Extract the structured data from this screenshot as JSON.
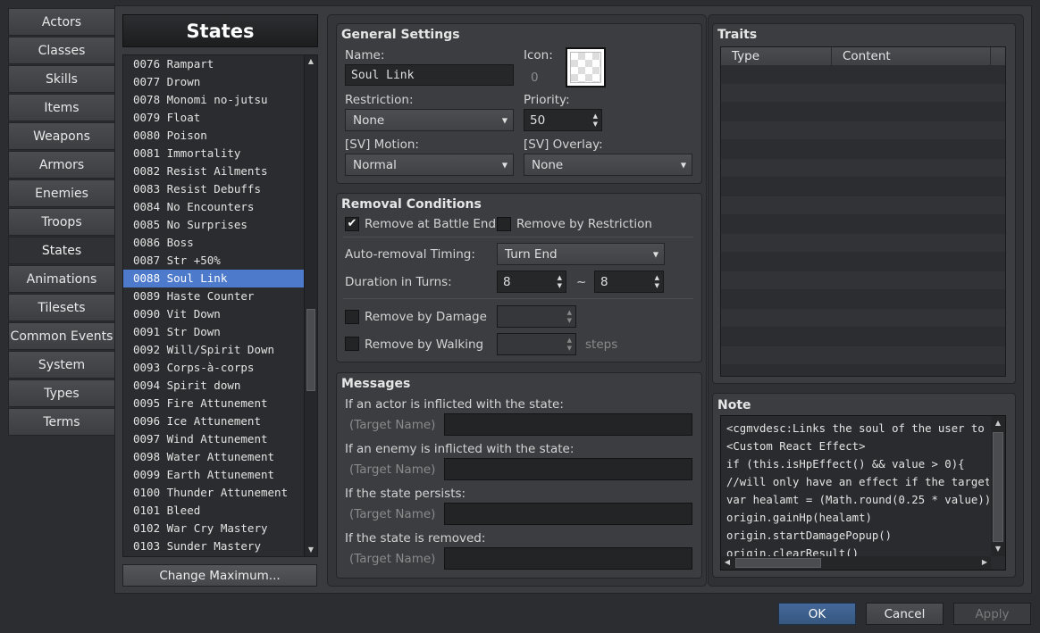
{
  "tabs": [
    "Actors",
    "Classes",
    "Skills",
    "Items",
    "Weapons",
    "Armors",
    "Enemies",
    "Troops",
    "States",
    "Animations",
    "Tilesets",
    "Common Events",
    "System",
    "Types",
    "Terms"
  ],
  "active_tab": "States",
  "list_header": "States",
  "list_items": [
    "0076 Rampart",
    "0077 Drown",
    "0078 Monomi no-jutsu",
    "0079 Float",
    "0080 Poison",
    "0081 Immortality",
    "0082 Resist Ailments",
    "0083 Resist Debuffs",
    "0084 No Encounters",
    "0085 No Surprises",
    "0086 Boss",
    "0087 Str +50%",
    "0088 Soul Link",
    "0089 Haste Counter",
    "0090 Vit Down",
    "0091 Str Down",
    "0092 Will/Spirit Down",
    "0093 Corps-à-corps",
    "0094 Spirit down",
    "0095 Fire Attunement",
    "0096 Ice Attunement",
    "0097 Wind Attunement",
    "0098 Water Attunement",
    "0099 Earth Attunement",
    "0100 Thunder Attunement",
    "0101 Bleed",
    "0102 War Cry Mastery",
    "0103 Sunder Mastery"
  ],
  "selected_item": "0088 Soul Link",
  "change_max_label": "Change Maximum...",
  "general": {
    "title": "General Settings",
    "name_label": "Name:",
    "name_value": "Soul Link",
    "icon_label": "Icon:",
    "icon_index": "0",
    "restriction_label": "Restriction:",
    "restriction_value": "None",
    "priority_label": "Priority:",
    "priority_value": "50",
    "motion_label": "[SV] Motion:",
    "motion_value": "Normal",
    "overlay_label": "[SV] Overlay:",
    "overlay_value": "None"
  },
  "removal": {
    "title": "Removal Conditions",
    "at_battle_end_label": "Remove at Battle End",
    "at_battle_end_checked": true,
    "by_restriction_label": "Remove by Restriction",
    "by_restriction_checked": false,
    "timing_label": "Auto-removal Timing:",
    "timing_value": "Turn End",
    "duration_label": "Duration in Turns:",
    "duration_min": "8",
    "duration_tilde": "~",
    "duration_max": "8",
    "by_damage_label": "Remove by Damage",
    "by_damage_checked": false,
    "by_walking_label": "Remove by Walking",
    "by_walking_checked": false,
    "steps_label": "steps"
  },
  "messages": {
    "title": "Messages",
    "items": [
      {
        "label": "If an actor is inflicted with the state:",
        "prefix": "(Target Name)",
        "value": ""
      },
      {
        "label": "If an enemy is inflicted with the state:",
        "prefix": "(Target Name)",
        "value": ""
      },
      {
        "label": "If the state persists:",
        "prefix": "(Target Name)",
        "value": ""
      },
      {
        "label": "If the state is removed:",
        "prefix": "(Target Name)",
        "value": ""
      }
    ]
  },
  "traits": {
    "title": "Traits",
    "col_type": "Type",
    "col_content": "Content"
  },
  "note": {
    "title": "Note",
    "lines": [
      "<cgmvdesc:Links the soul of the user to the",
      "<Custom React Effect>",
      "if (this.isHpEffect() && value > 0){",
      " //will only have an effect if the target w",
      " var healamt = (Math.round(0.25 * value))",
      " origin.gainHp(healamt)",
      " origin.startDamagePopup()",
      " origin.clearResult()"
    ]
  },
  "footer": {
    "ok": "OK",
    "cancel": "Cancel",
    "apply": "Apply"
  },
  "colors": {
    "selection": "#4d7acb",
    "ok_button": "#3d5f8e"
  }
}
